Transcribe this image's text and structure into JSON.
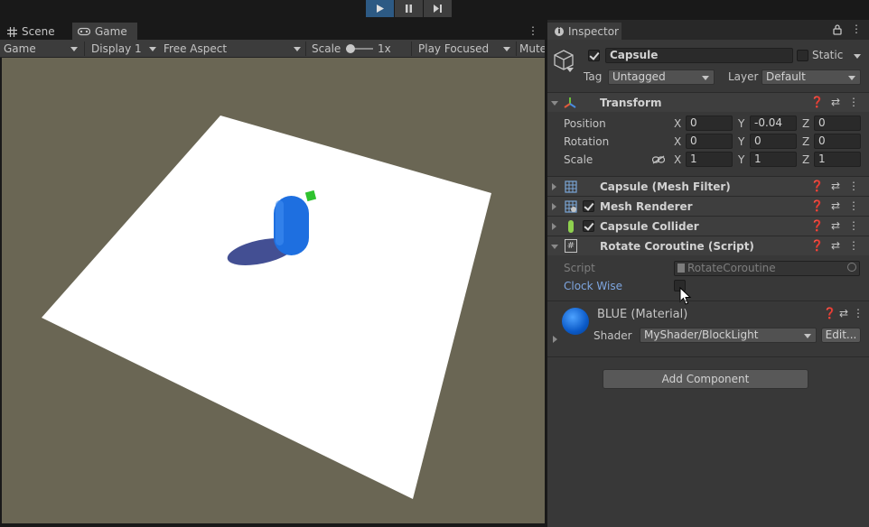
{
  "toolbar": {
    "play_icon": "play-icon",
    "pause_icon": "pause-icon",
    "step_icon": "step-icon"
  },
  "tabs": {
    "scene": "Scene",
    "game": "Game"
  },
  "game_bar": {
    "mode": "Game",
    "display": "Display 1",
    "aspect": "Free Aspect",
    "scale_label": "Scale",
    "scale_value": "1x",
    "play_focused": "Play Focused",
    "mute": "Mute"
  },
  "inspector": {
    "tab": "Inspector",
    "object": {
      "name": "Capsule",
      "static_label": "Static",
      "active": true,
      "tag_label": "Tag",
      "tag_value": "Untagged",
      "layer_label": "Layer",
      "layer_value": "Default"
    },
    "transform": {
      "title": "Transform",
      "rows": [
        {
          "label": "Position",
          "x": "0",
          "y": "-0.04",
          "z": "0"
        },
        {
          "label": "Rotation",
          "x": "0",
          "y": "0",
          "z": "0"
        },
        {
          "label": "Scale",
          "x": "1",
          "y": "1",
          "z": "1"
        }
      ],
      "axis_x": "X",
      "axis_y": "Y",
      "axis_z": "Z"
    },
    "components": [
      {
        "title": "Capsule (Mesh Filter)"
      },
      {
        "title": "Mesh Renderer"
      },
      {
        "title": "Capsule Collider"
      },
      {
        "title": "Rotate Coroutine (Script)"
      }
    ],
    "script": {
      "script_label": "Script",
      "script_value": "RotateCoroutine",
      "clockwise_label": "Clock Wise",
      "clockwise_checked": false
    },
    "material": {
      "name": "BLUE (Material)",
      "shader_label": "Shader",
      "shader_value": "MyShader/BlockLight",
      "edit_label": "Edit..."
    },
    "add_component": "Add Component"
  },
  "colors": {
    "accent": "#2d5a84",
    "capsule": "#1e6fe0",
    "plane": "#ffffff",
    "ground": "#6a6654",
    "link_label": "#7ea6e0"
  }
}
